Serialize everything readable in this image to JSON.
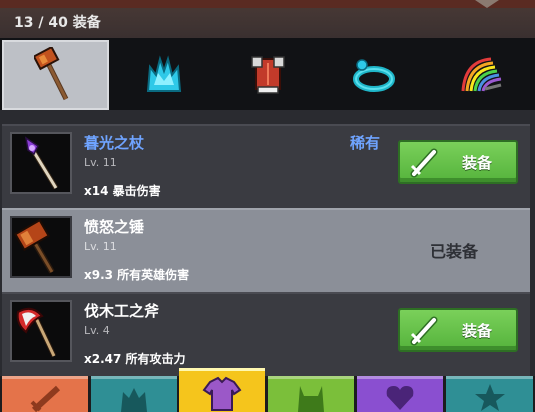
{
  "header": {
    "count_label": "13 / 40 装备"
  },
  "categories": [
    {
      "icon": "hammer-icon",
      "active": true
    },
    {
      "icon": "crown-icon",
      "active": false
    },
    {
      "icon": "armor-icon",
      "active": false
    },
    {
      "icon": "ring-icon",
      "active": false
    },
    {
      "icon": "rainbow-sword-icon",
      "active": false
    }
  ],
  "items": [
    {
      "name": "暮光之杖",
      "level": "Lv. 11",
      "stat": "x14 暴击伤害",
      "rarity": "稀有",
      "action": "装备",
      "icon": "staff-icon",
      "equipped": false
    },
    {
      "name": "愤怒之锤",
      "level": "Lv. 11",
      "stat": "x9.3 所有英雄伤害",
      "status": "已装备",
      "icon": "hammer-icon",
      "equipped": true
    },
    {
      "name": "伐木工之斧",
      "level": "Lv. 4",
      "stat": "x2.47 所有攻击力",
      "action": "装备",
      "icon": "axe-icon",
      "equipped": false
    }
  ],
  "bottom_tabs": [
    {
      "icon": "sword-icon",
      "color": "#e4734a",
      "active": false
    },
    {
      "icon": "helmet-icon",
      "color": "#2f8f95",
      "active": false
    },
    {
      "icon": "shirt-icon",
      "color": "#f5c51c",
      "active": true
    },
    {
      "icon": "horned-helm-icon",
      "color": "#7bbf3a",
      "active": false
    },
    {
      "icon": "heart-icon",
      "color": "#8a4fd0",
      "active": false
    },
    {
      "icon": "star-icon",
      "color": "#2f8f95",
      "active": false
    }
  ]
}
